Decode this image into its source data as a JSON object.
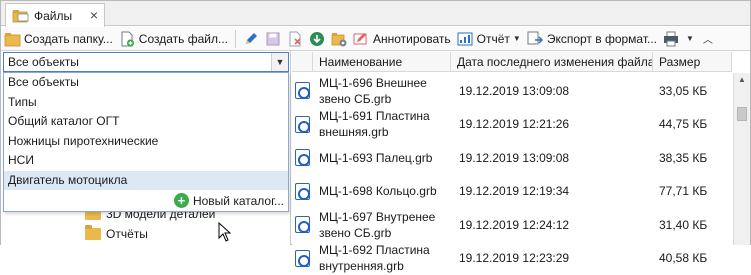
{
  "tab": {
    "label": "Файлы"
  },
  "toolbar": {
    "create_folder": "Создать папку...",
    "create_file": "Создать файл...",
    "annotate": "Аннотировать",
    "report": "Отчёт",
    "export": "Экспорт в формат..."
  },
  "filter": {
    "selected": "Все объекты",
    "options": [
      "Все объекты",
      "Типы",
      "Общий каталог ОГТ",
      "Ножницы пиротехнические",
      "НСИ",
      "Двигатель мотоцикла"
    ],
    "new_catalog": "Новый каталог..."
  },
  "tree": {
    "items": [
      "3D модели деталей",
      "Отчёты"
    ]
  },
  "table": {
    "columns": [
      "Наименование",
      "Дата последнего изменения файла",
      "Размер"
    ],
    "rows": [
      {
        "name": "МЦ-1-696 Внешнее звено СБ.grb",
        "date": "19.12.2019 13:09:08",
        "size": "33,05 КБ"
      },
      {
        "name": "МЦ-1-691 Пластина внешняя.grb",
        "date": "19.12.2019 12:21:26",
        "size": "44,75 КБ"
      },
      {
        "name": "МЦ-1-693 Палец.grb",
        "date": "19.12.2019 13:09:08",
        "size": "38,35 КБ"
      },
      {
        "name": "МЦ-1-698 Кольцо.grb",
        "date": "19.12.2019 12:19:34",
        "size": "77,71 КБ"
      },
      {
        "name": "МЦ-1-697 Внутренее звено СБ.grb",
        "date": "19.12.2019 12:24:12",
        "size": "31,40 КБ"
      },
      {
        "name": "МЦ-1-692 Пластина внутренняя.grb",
        "date": "19.12.2019 12:23:29",
        "size": "40,58 КБ"
      }
    ]
  },
  "colors": {
    "accent": "#4a83c4",
    "hover": "#dde8f5",
    "folder": "#e9b94c",
    "add_green": "#3daa4d"
  }
}
